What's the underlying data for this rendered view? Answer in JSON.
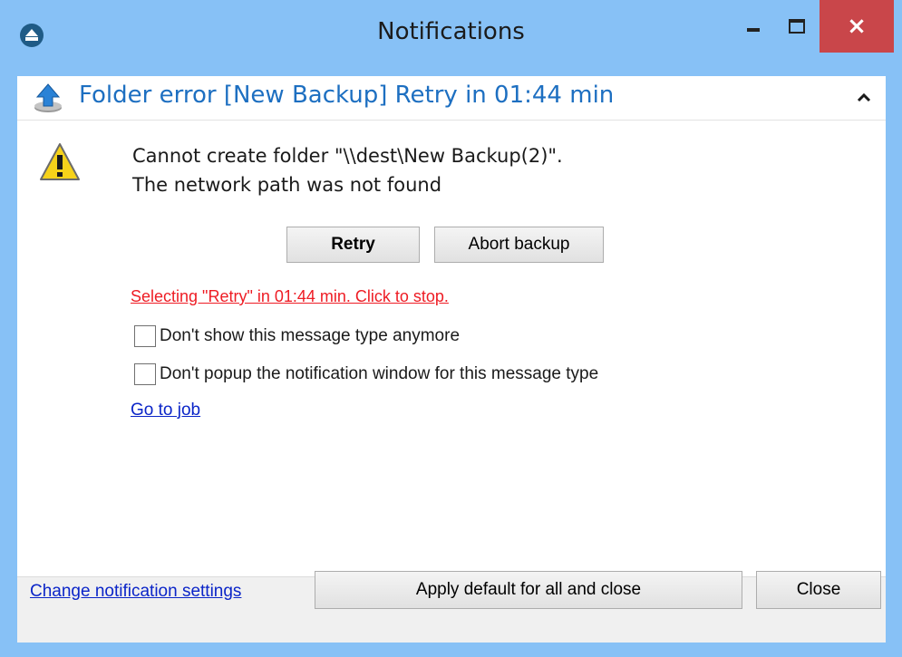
{
  "window": {
    "title": "Notifications",
    "close_glyph": "×"
  },
  "notification": {
    "header": "Folder error [New Backup] Retry in 01:44 min",
    "message_line1": "Cannot create folder \"\\\\dest\\New Backup(2)\".",
    "message_line2": "The network path was not found",
    "retry_label": "Retry",
    "abort_label": "Abort backup",
    "auto_retry_text": "Selecting \"Retry\" in 01:44 min. Click to stop.",
    "checkbox_dont_show": "Don't show this message type anymore",
    "checkbox_dont_popup": "Don't popup the notification window for this message type",
    "go_to_job": "Go to job"
  },
  "footer": {
    "change_settings": "Change notification settings",
    "apply_default": "Apply default for all and close",
    "close": "Close"
  },
  "colors": {
    "titlebar": "#87c1f6",
    "close_button": "#c9464a",
    "header_text": "#1d6fc1",
    "auto_retry": "#ee1c24",
    "link": "#0b25c8"
  },
  "icons": {
    "app": "app-logo-icon",
    "header": "upload-arrow-icon",
    "warning": "warning-triangle-icon",
    "collapse": "chevron-up-icon"
  }
}
